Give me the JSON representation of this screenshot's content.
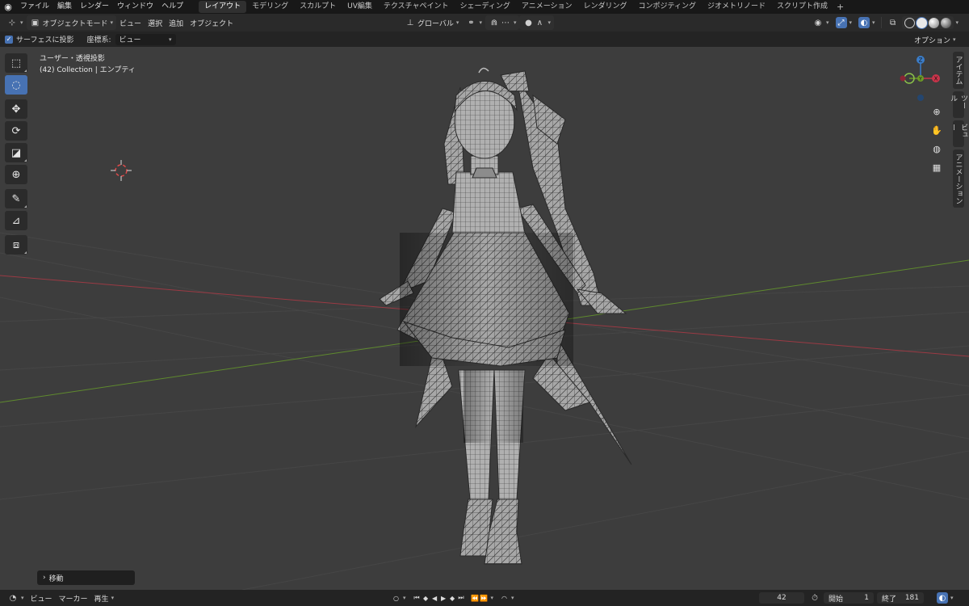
{
  "menubar": {
    "items": [
      "ファイル",
      "編集",
      "レンダー",
      "ウィンドウ",
      "ヘルプ"
    ],
    "workspace_tabs": [
      "レイアウト",
      "モデリング",
      "スカルプト",
      "UV編集",
      "テクスチャペイント",
      "シェーディング",
      "アニメーション",
      "レンダリング",
      "コンポジティング",
      "ジオメトリノード",
      "スクリプト作成"
    ],
    "active_tab": "レイアウト",
    "add_symbol": "+"
  },
  "header": {
    "mode": "オブジェクトモード",
    "menus": [
      "ビュー",
      "選択",
      "追加",
      "オブジェクト"
    ],
    "transform_orientation": "グローバル",
    "options": "オプション"
  },
  "tool_settings": {
    "snap_label": "サーフェスに投影",
    "coord_label": "座標系:",
    "coord_value": "ビュー"
  },
  "viewport": {
    "view_name": "ユーザー・透視投影",
    "collection_info": "(42) Collection | エンプティ",
    "last_operator": "移動",
    "side_tabs": [
      "アイテム",
      "ツール",
      "ビュー",
      "アニメーション"
    ],
    "gizmo": {
      "z": "Z",
      "y": "Y",
      "x": "X"
    }
  },
  "timeline": {
    "menus": [
      "ビュー",
      "マーカー"
    ],
    "playback": "再生",
    "current_frame": "42",
    "start_label": "開始",
    "start_value": "1",
    "end_label": "終了",
    "end_value": "181"
  },
  "colors": {
    "accent": "#4772b3",
    "viewport_bg": "#3d3d3d",
    "x_axis": "#9b3a44",
    "y_axis": "#5f8a2e"
  }
}
